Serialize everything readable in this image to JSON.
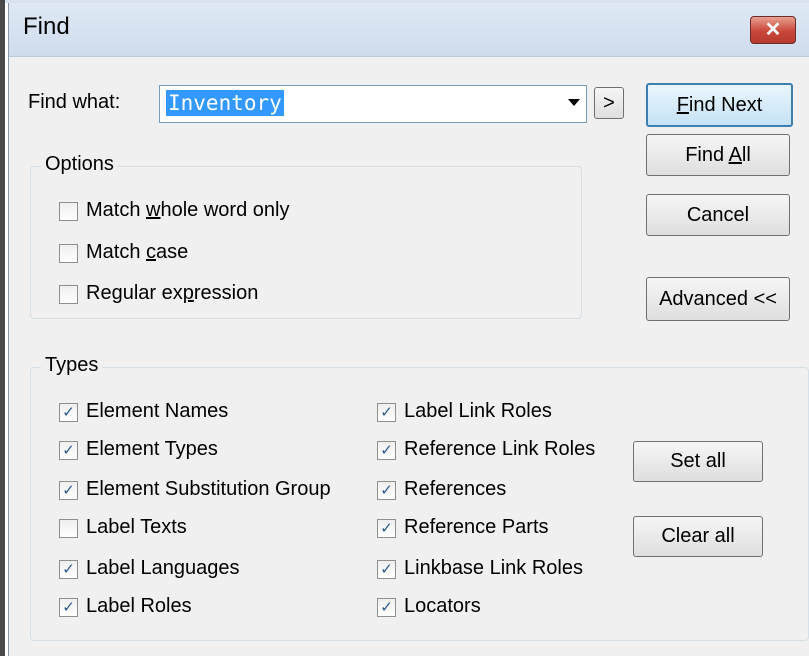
{
  "window": {
    "title": "Find",
    "close_glyph": "✕"
  },
  "find": {
    "label_pre": "Find what:",
    "value": "Inventory",
    "history_button": ">"
  },
  "buttons": {
    "find_next": {
      "pre": "",
      "key": "F",
      "post": "ind Next"
    },
    "find_all": {
      "pre": "Find ",
      "key": "A",
      "post": "ll"
    },
    "cancel": "Cancel",
    "advanced": "Advanced <<",
    "set_all": "Set all",
    "clear_all": "Clear all"
  },
  "options": {
    "title": "Options",
    "items": [
      {
        "pre": "Match ",
        "key": "w",
        "post": "hole word only",
        "checked": false
      },
      {
        "pre": "Match ",
        "key": "c",
        "post": "ase",
        "checked": false
      },
      {
        "pre": "Regular ex",
        "key": "p",
        "post": "ression",
        "checked": false
      }
    ]
  },
  "types": {
    "title": "Types",
    "left": [
      {
        "label": "Element Names",
        "checked": true
      },
      {
        "label": "Element Types",
        "checked": true
      },
      {
        "label": "Element Substitution Group",
        "checked": true
      },
      {
        "label": "Label Texts",
        "checked": false
      },
      {
        "label": "Label Languages",
        "checked": true
      },
      {
        "label": "Label Roles",
        "checked": true
      }
    ],
    "right": [
      {
        "label": "Label Link Roles",
        "checked": true
      },
      {
        "label": "Reference Link Roles",
        "checked": true
      },
      {
        "label": "References",
        "checked": true
      },
      {
        "label": "Reference Parts",
        "checked": true
      },
      {
        "label": "Linkbase Link Roles",
        "checked": true
      },
      {
        "label": "Locators",
        "checked": true
      }
    ]
  },
  "check_glyph": "✓",
  "icons": {
    "dropdown": "chevron-down-icon",
    "close": "close-icon",
    "checkmark": "checkmark-icon"
  }
}
